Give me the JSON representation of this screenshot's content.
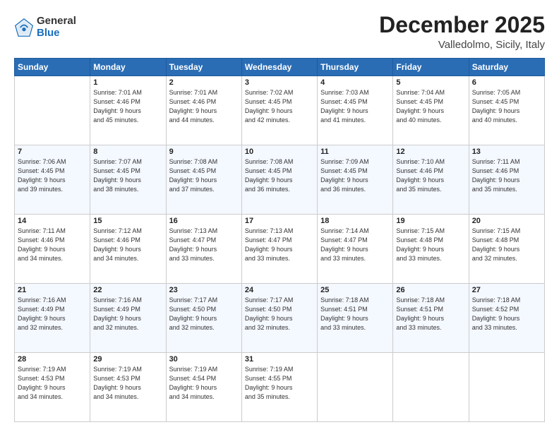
{
  "logo": {
    "general": "General",
    "blue": "Blue"
  },
  "header": {
    "month": "December 2025",
    "location": "Valledolmo, Sicily, Italy"
  },
  "weekdays": [
    "Sunday",
    "Monday",
    "Tuesday",
    "Wednesday",
    "Thursday",
    "Friday",
    "Saturday"
  ],
  "weeks": [
    [
      {
        "day": "",
        "info": ""
      },
      {
        "day": "1",
        "info": "Sunrise: 7:01 AM\nSunset: 4:46 PM\nDaylight: 9 hours\nand 45 minutes."
      },
      {
        "day": "2",
        "info": "Sunrise: 7:01 AM\nSunset: 4:46 PM\nDaylight: 9 hours\nand 44 minutes."
      },
      {
        "day": "3",
        "info": "Sunrise: 7:02 AM\nSunset: 4:45 PM\nDaylight: 9 hours\nand 42 minutes."
      },
      {
        "day": "4",
        "info": "Sunrise: 7:03 AM\nSunset: 4:45 PM\nDaylight: 9 hours\nand 41 minutes."
      },
      {
        "day": "5",
        "info": "Sunrise: 7:04 AM\nSunset: 4:45 PM\nDaylight: 9 hours\nand 40 minutes."
      },
      {
        "day": "6",
        "info": "Sunrise: 7:05 AM\nSunset: 4:45 PM\nDaylight: 9 hours\nand 40 minutes."
      }
    ],
    [
      {
        "day": "7",
        "info": "Sunrise: 7:06 AM\nSunset: 4:45 PM\nDaylight: 9 hours\nand 39 minutes."
      },
      {
        "day": "8",
        "info": "Sunrise: 7:07 AM\nSunset: 4:45 PM\nDaylight: 9 hours\nand 38 minutes."
      },
      {
        "day": "9",
        "info": "Sunrise: 7:08 AM\nSunset: 4:45 PM\nDaylight: 9 hours\nand 37 minutes."
      },
      {
        "day": "10",
        "info": "Sunrise: 7:08 AM\nSunset: 4:45 PM\nDaylight: 9 hours\nand 36 minutes."
      },
      {
        "day": "11",
        "info": "Sunrise: 7:09 AM\nSunset: 4:45 PM\nDaylight: 9 hours\nand 36 minutes."
      },
      {
        "day": "12",
        "info": "Sunrise: 7:10 AM\nSunset: 4:46 PM\nDaylight: 9 hours\nand 35 minutes."
      },
      {
        "day": "13",
        "info": "Sunrise: 7:11 AM\nSunset: 4:46 PM\nDaylight: 9 hours\nand 35 minutes."
      }
    ],
    [
      {
        "day": "14",
        "info": "Sunrise: 7:11 AM\nSunset: 4:46 PM\nDaylight: 9 hours\nand 34 minutes."
      },
      {
        "day": "15",
        "info": "Sunrise: 7:12 AM\nSunset: 4:46 PM\nDaylight: 9 hours\nand 34 minutes."
      },
      {
        "day": "16",
        "info": "Sunrise: 7:13 AM\nSunset: 4:47 PM\nDaylight: 9 hours\nand 33 minutes."
      },
      {
        "day": "17",
        "info": "Sunrise: 7:13 AM\nSunset: 4:47 PM\nDaylight: 9 hours\nand 33 minutes."
      },
      {
        "day": "18",
        "info": "Sunrise: 7:14 AM\nSunset: 4:47 PM\nDaylight: 9 hours\nand 33 minutes."
      },
      {
        "day": "19",
        "info": "Sunrise: 7:15 AM\nSunset: 4:48 PM\nDaylight: 9 hours\nand 33 minutes."
      },
      {
        "day": "20",
        "info": "Sunrise: 7:15 AM\nSunset: 4:48 PM\nDaylight: 9 hours\nand 32 minutes."
      }
    ],
    [
      {
        "day": "21",
        "info": "Sunrise: 7:16 AM\nSunset: 4:49 PM\nDaylight: 9 hours\nand 32 minutes."
      },
      {
        "day": "22",
        "info": "Sunrise: 7:16 AM\nSunset: 4:49 PM\nDaylight: 9 hours\nand 32 minutes."
      },
      {
        "day": "23",
        "info": "Sunrise: 7:17 AM\nSunset: 4:50 PM\nDaylight: 9 hours\nand 32 minutes."
      },
      {
        "day": "24",
        "info": "Sunrise: 7:17 AM\nSunset: 4:50 PM\nDaylight: 9 hours\nand 32 minutes."
      },
      {
        "day": "25",
        "info": "Sunrise: 7:18 AM\nSunset: 4:51 PM\nDaylight: 9 hours\nand 33 minutes."
      },
      {
        "day": "26",
        "info": "Sunrise: 7:18 AM\nSunset: 4:51 PM\nDaylight: 9 hours\nand 33 minutes."
      },
      {
        "day": "27",
        "info": "Sunrise: 7:18 AM\nSunset: 4:52 PM\nDaylight: 9 hours\nand 33 minutes."
      }
    ],
    [
      {
        "day": "28",
        "info": "Sunrise: 7:19 AM\nSunset: 4:53 PM\nDaylight: 9 hours\nand 34 minutes."
      },
      {
        "day": "29",
        "info": "Sunrise: 7:19 AM\nSunset: 4:53 PM\nDaylight: 9 hours\nand 34 minutes."
      },
      {
        "day": "30",
        "info": "Sunrise: 7:19 AM\nSunset: 4:54 PM\nDaylight: 9 hours\nand 34 minutes."
      },
      {
        "day": "31",
        "info": "Sunrise: 7:19 AM\nSunset: 4:55 PM\nDaylight: 9 hours\nand 35 minutes."
      },
      {
        "day": "",
        "info": ""
      },
      {
        "day": "",
        "info": ""
      },
      {
        "day": "",
        "info": ""
      }
    ]
  ]
}
